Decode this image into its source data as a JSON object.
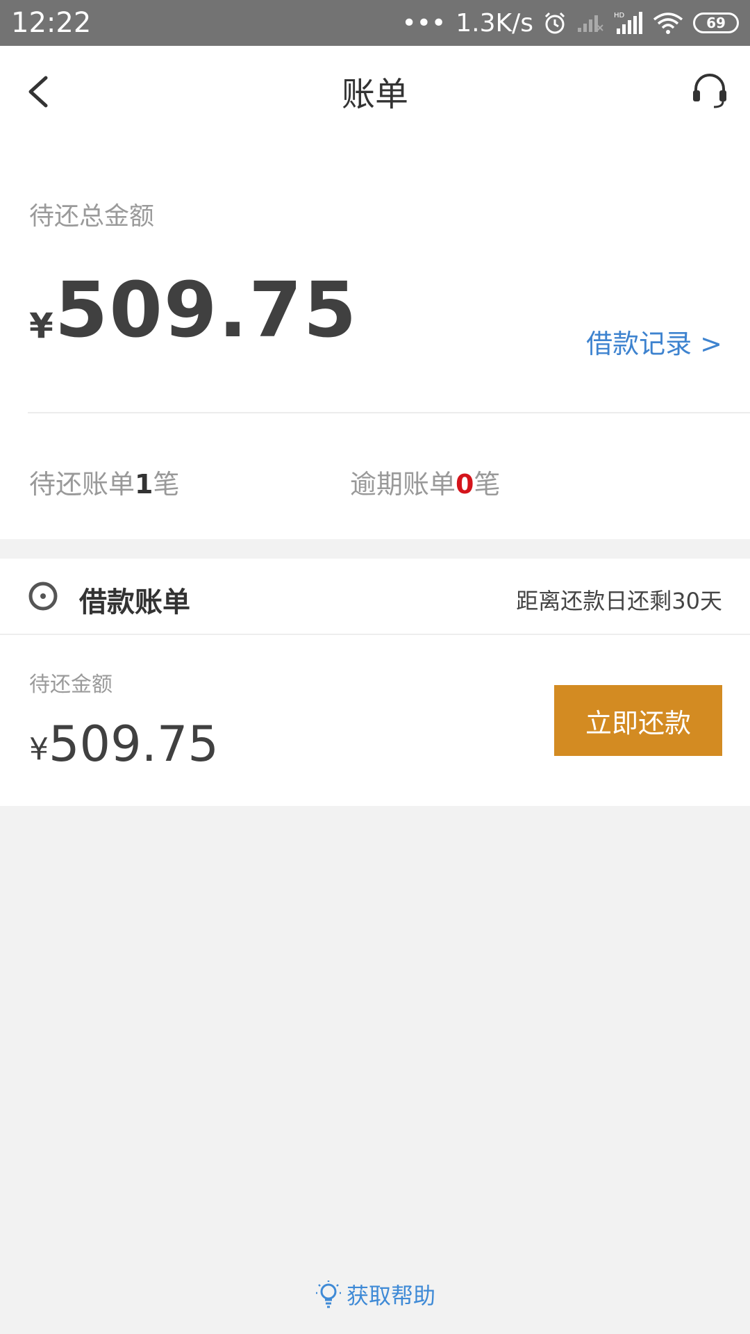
{
  "status_bar": {
    "time": "12:22",
    "network_speed": "1.3K/s",
    "battery": "69"
  },
  "header": {
    "title": "账单"
  },
  "summary": {
    "total_label": "待还总金额",
    "currency": "¥",
    "total_amount": "509.75",
    "loan_record_label": "借款记录 >",
    "pending_prefix": "待还账单",
    "pending_count": "1",
    "pending_suffix": "笔",
    "overdue_prefix": "逾期账单",
    "overdue_count": "0",
    "overdue_suffix": "笔"
  },
  "bill": {
    "title": "借款账单",
    "days_text": "距离还款日还剩30天",
    "amount_label": "待还金额",
    "currency": "¥",
    "amount": "509.75",
    "repay_label": "立即还款"
  },
  "footer": {
    "help_label": "获取帮助"
  },
  "colors": {
    "accent_blue": "#3e83cf",
    "repay_orange": "#d38b22",
    "overdue_red": "#d4141b"
  }
}
